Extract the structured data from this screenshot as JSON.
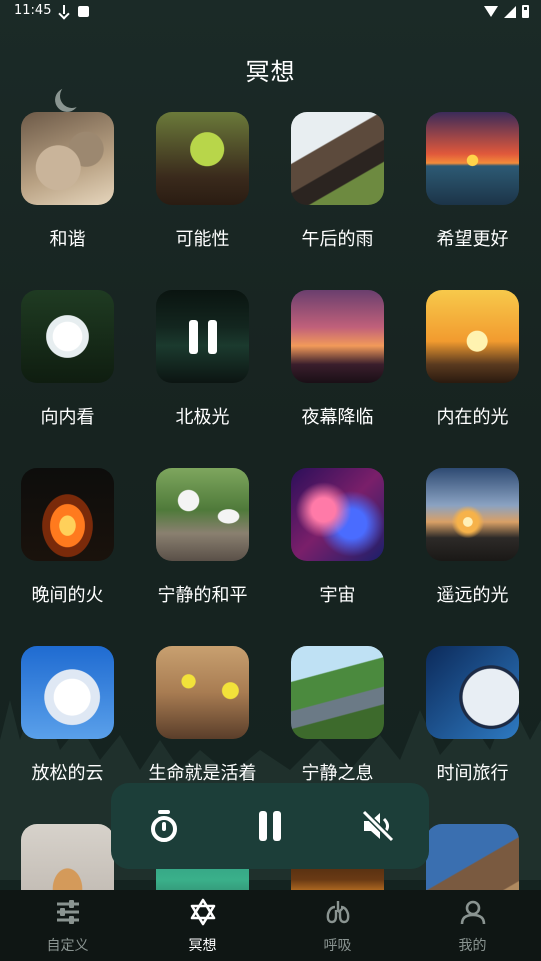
{
  "status_bar": {
    "time": "11:45"
  },
  "page_title": "冥想",
  "grid": {
    "items": [
      {
        "label": "和谐",
        "image": "zen-stones-image"
      },
      {
        "label": "可能性",
        "image": "sprout-image"
      },
      {
        "label": "午后的雨",
        "image": "rainy-roof-image"
      },
      {
        "label": "希望更好",
        "image": "sunset-sea-image"
      },
      {
        "label": "向内看",
        "image": "lotus-image"
      },
      {
        "label": "北极光",
        "image": "aurora-image",
        "playing": true
      },
      {
        "label": "夜幕降临",
        "image": "dusk-sky-image"
      },
      {
        "label": "内在的光",
        "image": "sunrise-yoga-image"
      },
      {
        "label": "晚间的火",
        "image": "campfire-image"
      },
      {
        "label": "宁静的和平",
        "image": "doves-image"
      },
      {
        "label": "宇宙",
        "image": "nebula-image"
      },
      {
        "label": "遥远的光",
        "image": "horizon-sun-image"
      },
      {
        "label": "放松的云",
        "image": "clouds-image"
      },
      {
        "label": "生命就是活着",
        "image": "mushrooms-image"
      },
      {
        "label": "宁静之息",
        "image": "country-road-image"
      },
      {
        "label": "时间旅行",
        "image": "clock-image"
      },
      {
        "label": "",
        "image": "sleeping-cat-image"
      },
      {
        "label": "",
        "image": "reef-image"
      },
      {
        "label": "",
        "image": "light-trails-image"
      },
      {
        "label": "",
        "image": "climber-image"
      }
    ]
  },
  "player": {
    "timer_icon": "timer-icon",
    "pause_icon": "pause-icon",
    "mute_icon": "volume-mute-icon"
  },
  "bottom_nav": {
    "items": [
      {
        "label": "自定义",
        "icon": "sliders-icon",
        "active": false
      },
      {
        "label": "冥想",
        "icon": "star-of-david-icon",
        "active": true
      },
      {
        "label": "呼吸",
        "icon": "lungs-icon",
        "active": false
      },
      {
        "label": "我的",
        "icon": "user-icon",
        "active": false
      }
    ]
  },
  "colors": {
    "background": "#172320",
    "player_bar": "#1c3e39",
    "nav_bar": "#0f1614",
    "inactive_nav": "#8a9491"
  }
}
